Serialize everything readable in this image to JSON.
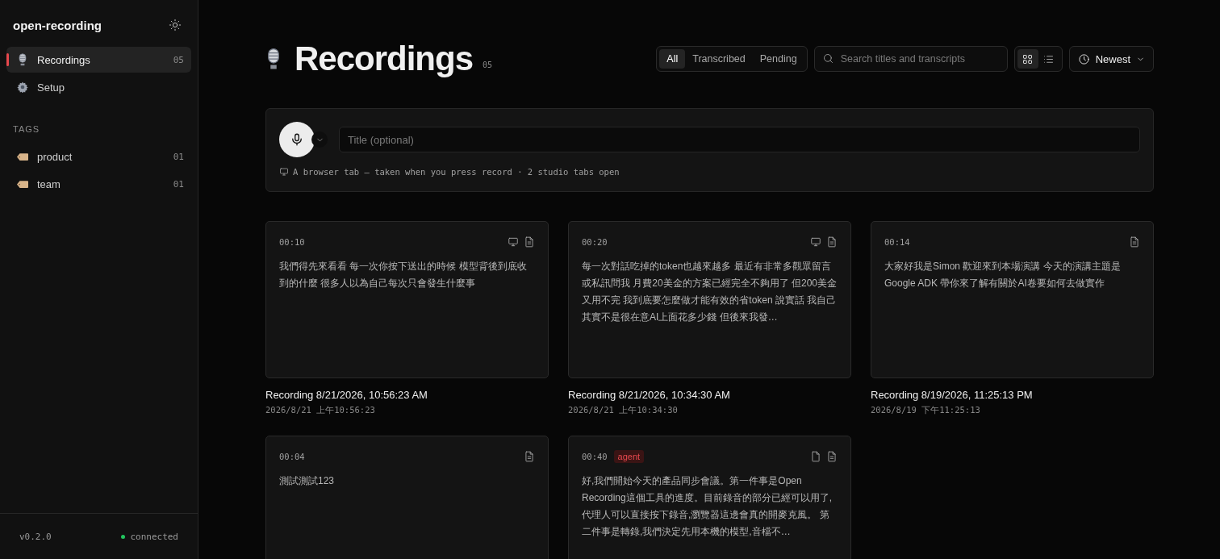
{
  "sidebar": {
    "app_name": "open-recording",
    "nav": [
      {
        "label": "Recordings",
        "count": "05",
        "selected": true
      },
      {
        "label": "Setup",
        "selected": false
      }
    ],
    "tags_heading": "TAGS",
    "tags": [
      {
        "label": "product",
        "count": "01"
      },
      {
        "label": "team",
        "count": "01"
      }
    ],
    "version": "v0.2.0",
    "connection": {
      "label": "connected",
      "online": true
    }
  },
  "header": {
    "title": "Recordings",
    "count": "05",
    "filters": [
      {
        "label": "All",
        "selected": true
      },
      {
        "label": "Transcribed",
        "selected": false
      },
      {
        "label": "Pending",
        "selected": false
      }
    ],
    "search": {
      "placeholder": "Search titles and transcripts"
    },
    "views": [
      {
        "kind": "grid",
        "selected": true
      },
      {
        "kind": "list",
        "selected": false
      }
    ],
    "sort": {
      "label": "Newest"
    }
  },
  "recorder": {
    "title_field": {
      "placeholder": "Title (optional)"
    },
    "source_note": "A browser tab — taken when you press record · 2 studio tabs open"
  },
  "recordings": [
    {
      "duration": "00:10",
      "screen_capture": true,
      "transcript_ready": true,
      "transcript": "我們得先來看看 每一次你按下送出的時候 模型背後到底收到的什麼 很多人以為自己每次只會發生什麼事",
      "title": "Recording 8/21/2026, 10:56:23 AM",
      "date": "2026/8/21 上午10:56:23"
    },
    {
      "duration": "00:20",
      "screen_capture": true,
      "transcript_ready": true,
      "transcript": "每一次對話吃掉的token也越來越多 最近有非常多觀眾留言或私訊問我 月費20美金的方案已經完全不夠用了 但200美金又用不完 我到底要怎麼做才能有效的省token 說實話 我自己其實不是很在意AI上面花多少錢 但後來我發…",
      "title": "Recording 8/21/2026, 10:34:30 AM",
      "date": "2026/8/21 上午10:34:30"
    },
    {
      "duration": "00:14",
      "transcript_ready": true,
      "transcript": "大家好我是Simon 歡迎來到本場演講 今天的演講主題是Google ADK 帶你來了解有關於AI卷要如何去做實作",
      "title": "Recording 8/19/2026, 11:25:13 PM",
      "date": "2026/8/19 下午11:25:13"
    },
    {
      "duration": "00:04",
      "transcript_ready": true,
      "transcript": "測試測試123"
    },
    {
      "duration": "00:40",
      "tag": "agent",
      "attachment": true,
      "transcript_ready": true,
      "transcript": "好,我們開始今天的產品同步會議。第一件事是Open Recording這個工具的進度。目前錄音的部分已經可以用了,代理人可以直接按下錄音,瀏覽器這邊會真的開麥克風。 第二件事是轉錄,我們決定先用本機的模型,音檔不…"
    }
  ]
}
